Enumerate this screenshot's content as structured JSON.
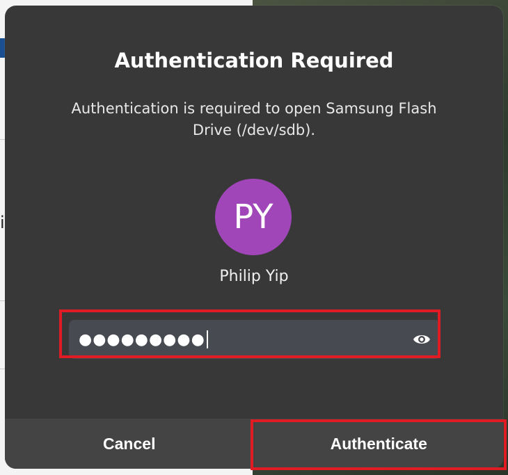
{
  "dialog": {
    "title": "Authentication Required",
    "message": "Authentication is required to open Samsung Flash Drive (/dev/sdb).",
    "avatar_initials": "PY",
    "avatar_color": "#a146b8",
    "username": "Philip Yip",
    "password_value": "●●●●●●●●●",
    "reveal_icon": "eye-icon",
    "cancel_label": "Cancel",
    "authenticate_label": "Authenticate"
  },
  "background": {
    "edge_glyph": "i"
  },
  "colors": {
    "dialog_bg": "#383838",
    "field_bg": "#474a50",
    "highlight": "#e01b24"
  }
}
